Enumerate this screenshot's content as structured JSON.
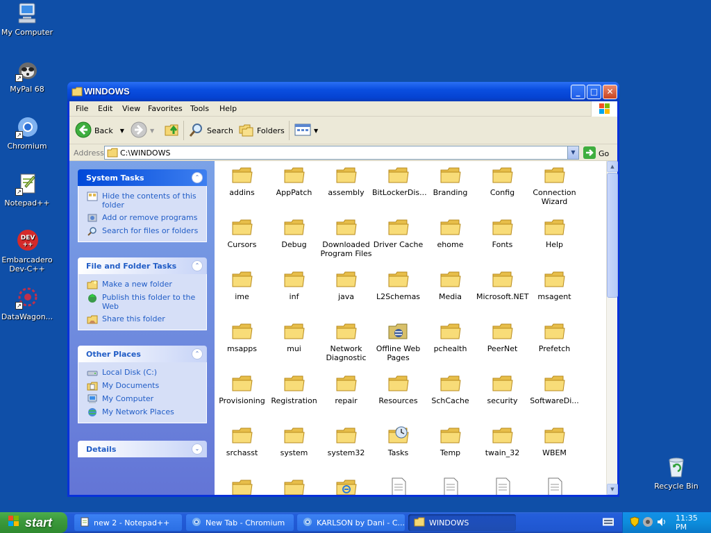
{
  "desktop": {
    "icons": [
      {
        "label": "My Computer"
      },
      {
        "label": "MyPal 68"
      },
      {
        "label": "Chromium"
      },
      {
        "label": "Notepad++"
      },
      {
        "label": "Embarcadero Dev-C++"
      },
      {
        "label": "DataWagon..."
      }
    ],
    "recycle_bin": "Recycle Bin"
  },
  "window": {
    "title": "WINDOWS",
    "menu": [
      "File",
      "Edit",
      "View",
      "Favorites",
      "Tools",
      "Help"
    ],
    "toolbar": {
      "back": "Back",
      "search": "Search",
      "folders": "Folders"
    },
    "address": {
      "label": "Address",
      "value": "C:\\WINDOWS",
      "go": "Go"
    },
    "taskpane": {
      "system_tasks": {
        "title": "System Tasks",
        "links": [
          "Hide the contents of this folder",
          "Add or remove programs",
          "Search for files or folders"
        ]
      },
      "file_folder_tasks": {
        "title": "File and Folder Tasks",
        "links": [
          "Make a new folder",
          "Publish this folder to the Web",
          "Share this folder"
        ]
      },
      "other_places": {
        "title": "Other Places",
        "links": [
          "Local Disk (C:)",
          "My Documents",
          "My Computer",
          "My Network Places"
        ]
      },
      "details": {
        "title": "Details"
      }
    },
    "items": [
      "addins",
      "AppPatch",
      "assembly",
      "BitLockerDis...",
      "Branding",
      "Config",
      "Connection Wizard",
      "Cursors",
      "Debug",
      "Downloaded Program Files",
      "Driver Cache",
      "ehome",
      "Fonts",
      "Help",
      "ime",
      "inf",
      "java",
      "L2Schemas",
      "Media",
      "Microsoft.NET",
      "msagent",
      "msapps",
      "mui",
      "Network Diagnostic",
      "Offline Web Pages",
      "pchealth",
      "PeerNet",
      "Prefetch",
      "Provisioning",
      "Registration",
      "repair",
      "Resources",
      "SchCache",
      "security",
      "SoftwareDi...",
      "srchasst",
      "system",
      "system32",
      "Tasks",
      "Temp",
      "twain_32",
      "WBEM"
    ]
  },
  "taskbar": {
    "start": "start",
    "tasks": [
      {
        "label": "new 2 - Notepad++"
      },
      {
        "label": "New Tab - Chromium"
      },
      {
        "label": "KARLSON by Dani - C..."
      },
      {
        "label": "WINDOWS"
      }
    ],
    "clock": "11:35 PM"
  }
}
